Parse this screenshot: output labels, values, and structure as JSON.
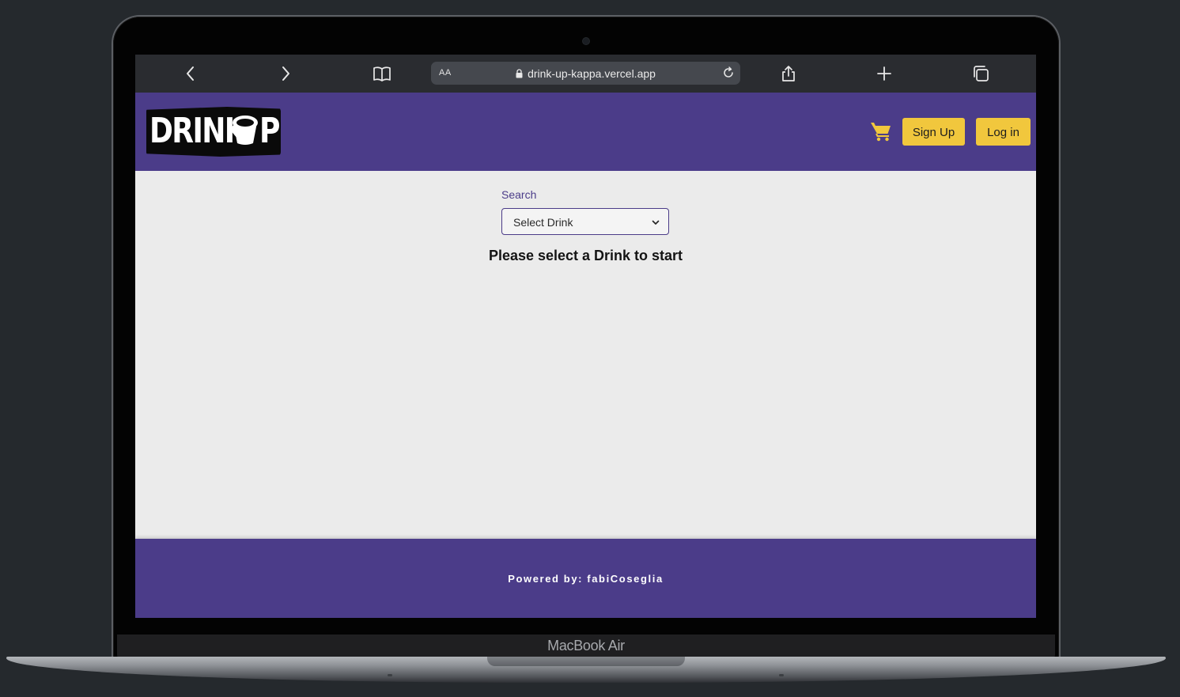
{
  "device": {
    "label": "MacBook Air"
  },
  "browser": {
    "url": "drink-up-kappa.vercel.app",
    "reader_label": "AA",
    "icons": [
      "back-icon",
      "forward-icon",
      "bookmarks-icon",
      "lock-icon",
      "reload-icon",
      "share-icon",
      "new-tab-icon",
      "tabs-icon"
    ]
  },
  "header": {
    "logo_text": "DRINK",
    "logo_text_end": "P",
    "cart_icon": "cart-icon",
    "signup_label": "Sign Up",
    "login_label": "Log in"
  },
  "main": {
    "search_label": "Search",
    "select_value": "Select Drink",
    "prompt": "Please select a Drink to start"
  },
  "footer": {
    "text": "Powered by: fabiCoseglia"
  },
  "colors": {
    "brand_purple": "#4b3c89",
    "button_yellow": "#f1c73d",
    "page_bg": "#ebebeb",
    "backdrop": "#25292d"
  }
}
